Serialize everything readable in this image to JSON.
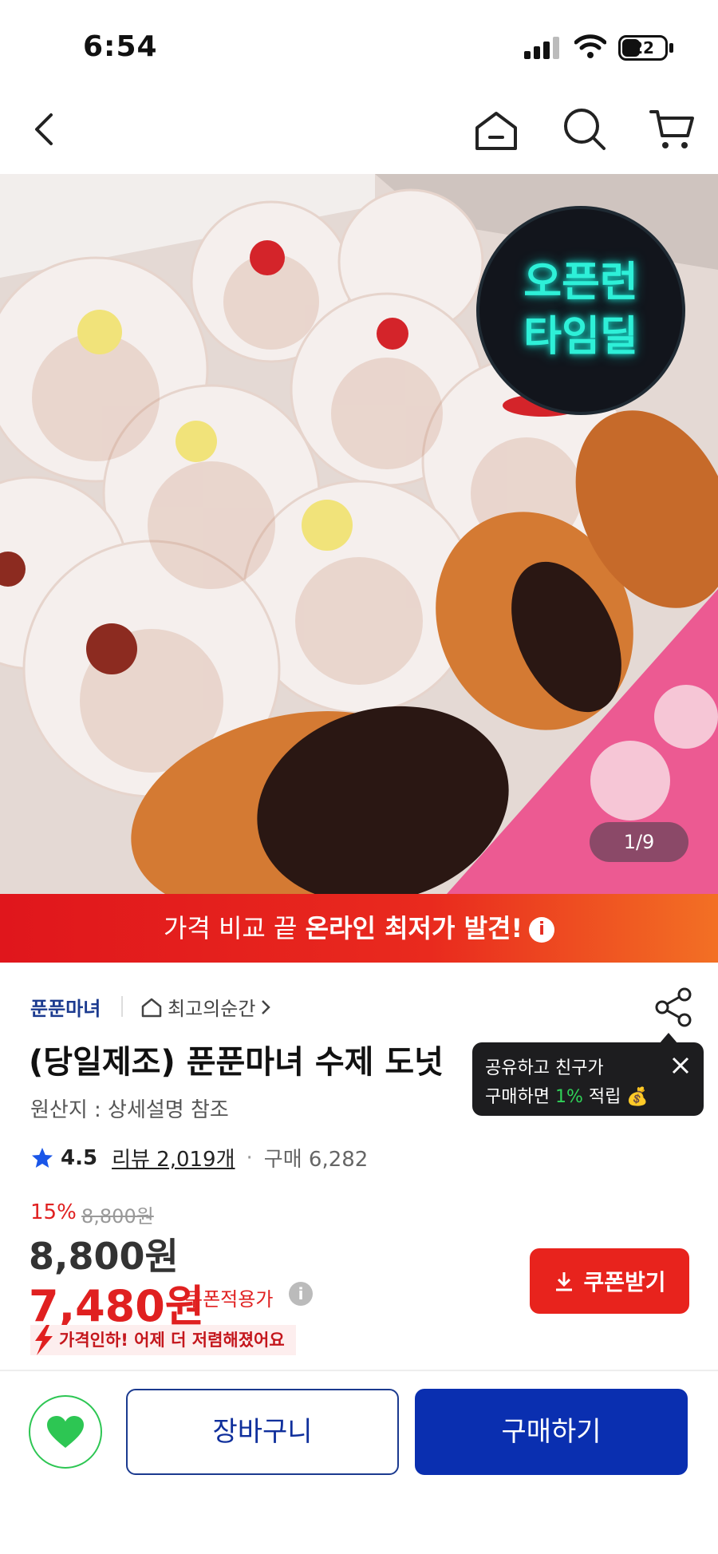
{
  "status_bar": {
    "time": "6:54",
    "battery": "22"
  },
  "image": {
    "badge_line1": "오픈런",
    "badge_line2": "타임딜",
    "pager": "1/9"
  },
  "banner": {
    "text_plain": "가격 비교 끝 ",
    "text_bold": "온라인 최저가 발견!",
    "info": "i"
  },
  "seller": {
    "name": "푼푼마녀",
    "store_link": "최고의순간"
  },
  "product": {
    "title": "(당일제조) 푼푼마녀 수제 도넛",
    "origin": "원산지 : 상세설명 참조",
    "rating": "4.5",
    "reviews": "리뷰 2,019개",
    "purchases": "구매 6,282"
  },
  "tooltip": {
    "line1": "공유하고 친구가",
    "line2_a": "구매하면 ",
    "line2_pct": "1%",
    "line2_b": " 적립 💰"
  },
  "price": {
    "discount": "15%",
    "original": "8,800원",
    "sale": "8,800원",
    "coupon": "7,480원",
    "coupon_label": "쿠폰적용가",
    "drop_notice": "가격인하! 어제 더 저렴해졌어요",
    "coupon_button": "쿠폰받기"
  },
  "bottom_bar": {
    "cart": "장바구니",
    "buy": "구매하기"
  },
  "colors": {
    "brand_blue": "#0a2fb0",
    "accent_red": "#e02020",
    "wish_green": "#2dc653"
  }
}
